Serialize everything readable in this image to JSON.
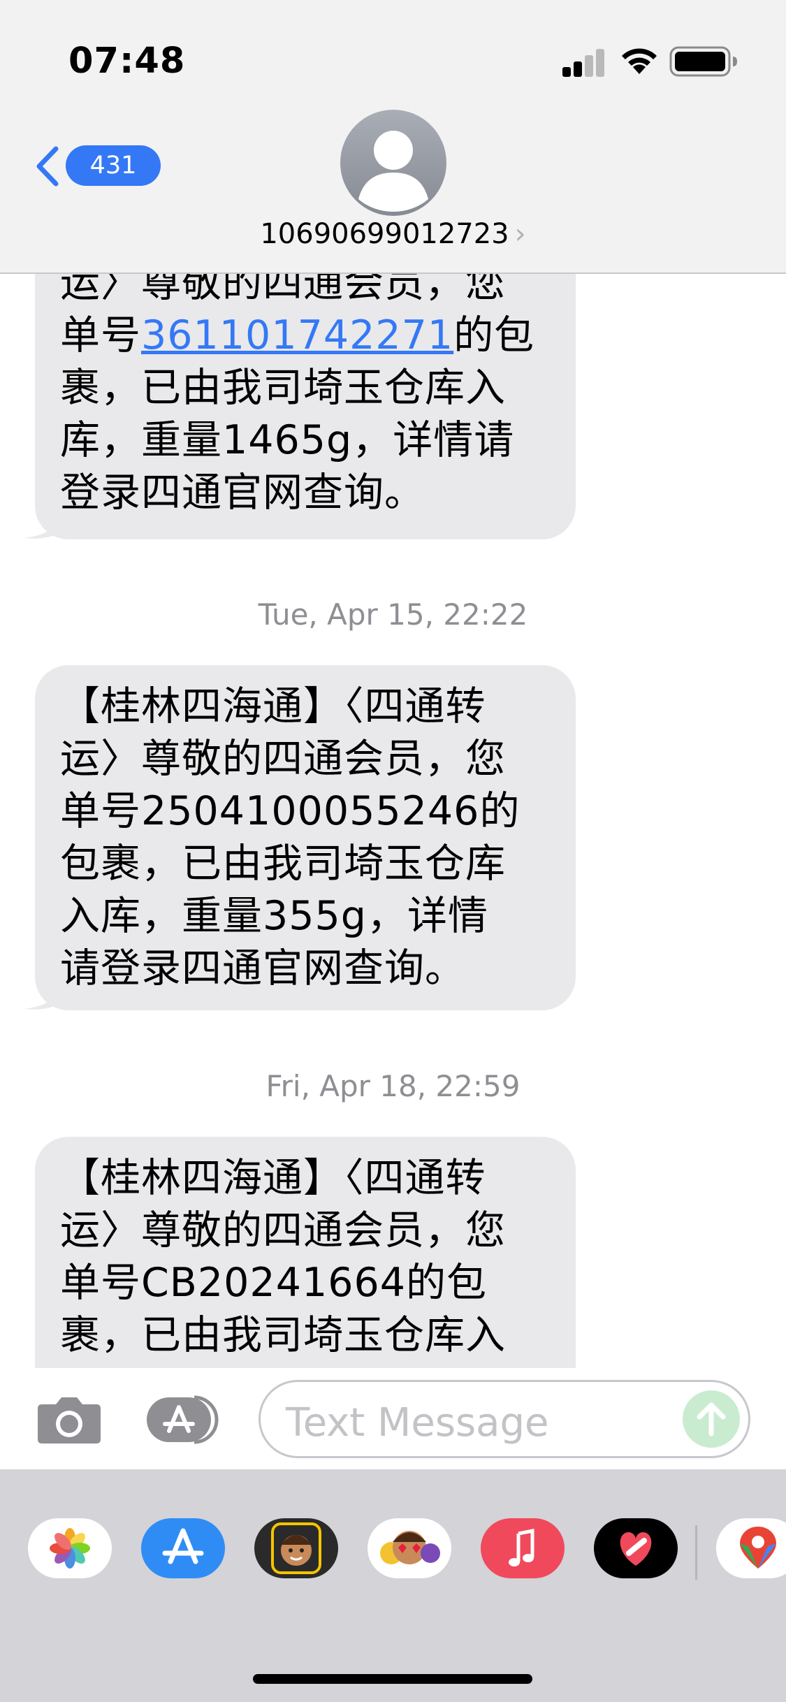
{
  "status_bar": {
    "time": "07:48"
  },
  "header": {
    "back_badge": "431",
    "contact_name": "10690699012723",
    "contact_chevron": "›"
  },
  "messages": [
    {
      "lines": [
        "运〉尊敬的四通会员，您"
      ],
      "link_line_prefix": "单号",
      "link_text": "361101742271",
      "link_line_suffix": "的包",
      "rest_lines": [
        "裹，已由我司埼玉仓库入",
        "库，重量1465g，详情请",
        "登录四通官网查询。"
      ]
    },
    {
      "timestamp": "Tue, Apr 15, 22:22",
      "lines": [
        "【桂林四海通】〈四通转",
        "运〉尊敬的四通会员，您",
        "单号2504100055246的",
        "包裹，已由我司埼玉仓库",
        "入库，重量355g，详情",
        "请登录四通官网查询。"
      ]
    },
    {
      "timestamp": "Fri, Apr 18, 22:59",
      "lines": [
        "【桂林四海通】〈四通转",
        "运〉尊敬的四通会员，您",
        "单号CB20241664的包",
        "裹，已由我司埼玉仓库入"
      ]
    }
  ],
  "input_bar": {
    "placeholder": "Text Message"
  },
  "drawer_apps": [
    "photos-icon",
    "app-store-icon",
    "memoji-sticker-icon",
    "animoji-icon",
    "music-icon",
    "digital-touch-icon",
    "maps-icon"
  ],
  "colors": {
    "bubble_gray": "#e9e9eb",
    "link_blue": "#3478f6",
    "header_bg": "#f2f2f2",
    "drawer_bg": "#d3d3d8"
  }
}
